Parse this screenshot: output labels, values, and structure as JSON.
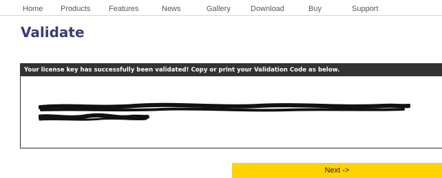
{
  "nav": {
    "items": [
      {
        "label": "Home"
      },
      {
        "label": "Products"
      },
      {
        "label": "Features"
      },
      {
        "label": "News"
      },
      {
        "label": "Gallery"
      },
      {
        "label": "Download"
      },
      {
        "label": "Buy"
      },
      {
        "label": "Support"
      }
    ]
  },
  "page": {
    "title": "Validate"
  },
  "validation": {
    "message": "Your license key has successfully been validated! Copy or print your Validation Code as below."
  },
  "actions": {
    "next_label": "Next ->"
  },
  "colors": {
    "title": "#3b3a78",
    "panel_header_bg": "#333333",
    "next_button_bg": "#ffd200"
  }
}
